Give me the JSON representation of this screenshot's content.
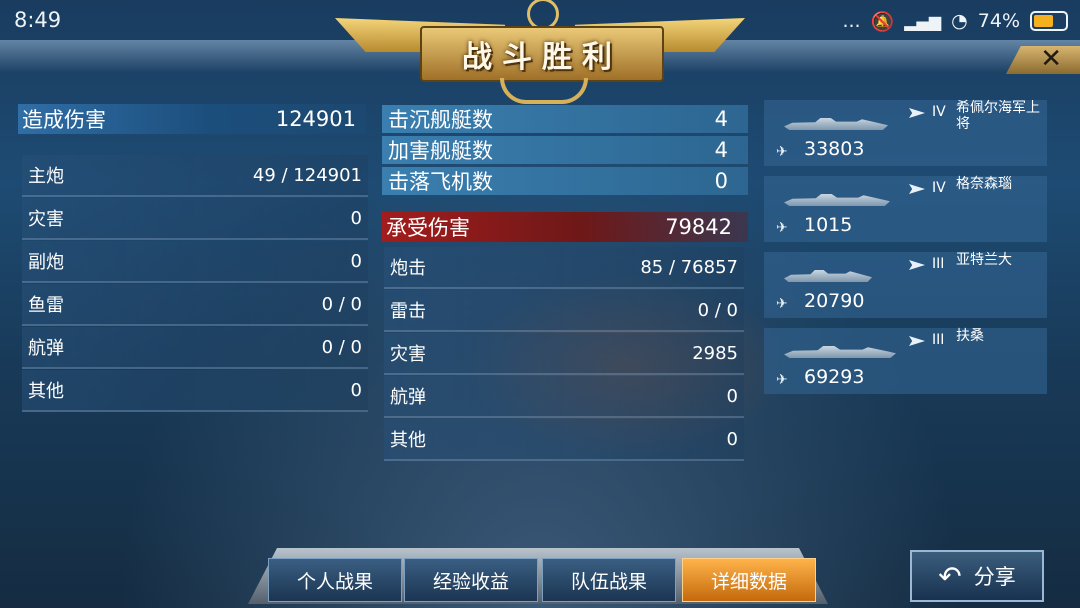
{
  "status_bar": {
    "time": "8:49",
    "dots": "...",
    "battery": "74%",
    "battery_level": 0.74
  },
  "banner": {
    "title": "战斗胜利"
  },
  "close": {
    "label": "✕"
  },
  "damage_dealt": {
    "title": "造成伤害",
    "total": "124901",
    "rows": [
      {
        "label": "主炮",
        "value": "49 / 124901"
      },
      {
        "label": "灾害",
        "value": "0"
      },
      {
        "label": "副炮",
        "value": "0"
      },
      {
        "label": "鱼雷",
        "value": "0 / 0"
      },
      {
        "label": "航弹",
        "value": "0 / 0"
      },
      {
        "label": "其他",
        "value": "0"
      }
    ]
  },
  "kills": [
    {
      "label": "击沉舰艇数",
      "value": "4"
    },
    {
      "label": "加害舰艇数",
      "value": "4"
    },
    {
      "label": "击落飞机数",
      "value": "0"
    }
  ],
  "damage_taken": {
    "title": "承受伤害",
    "total": "79842",
    "rows": [
      {
        "label": "炮击",
        "value": "85 / 76857"
      },
      {
        "label": "雷击",
        "value": "0 / 0"
      },
      {
        "label": "灾害",
        "value": "2985"
      },
      {
        "label": "航弹",
        "value": "0"
      },
      {
        "label": "其他",
        "value": "0"
      }
    ]
  },
  "ships": [
    {
      "tier": "IV",
      "name": "希佩尔海军上将",
      "damage": "33803"
    },
    {
      "tier": "IV",
      "name": "格奈森瑙",
      "damage": "1015"
    },
    {
      "tier": "III",
      "name": "亚特兰大",
      "damage": "20790"
    },
    {
      "tier": "III",
      "name": "扶桑",
      "damage": "69293"
    }
  ],
  "tabs": [
    {
      "label": "个人战果",
      "active": false
    },
    {
      "label": "经验收益",
      "active": false
    },
    {
      "label": "队伍战果",
      "active": false
    },
    {
      "label": "详细数据",
      "active": true
    }
  ],
  "share": {
    "label": "分享"
  }
}
